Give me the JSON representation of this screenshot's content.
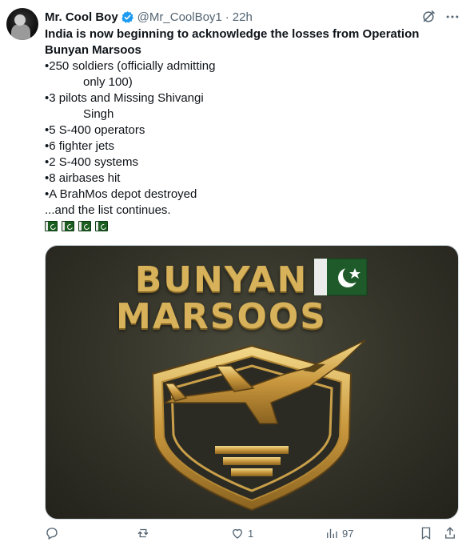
{
  "tweet": {
    "author_name": "Mr. Cool Boy",
    "handle": "@Mr_CoolBoy1",
    "separator": "·",
    "time": "22h",
    "title": "India is now beginning to acknowledge the losses from Operation Bunyan Marsoos",
    "lines": [
      "•250 soldiers (officially admitting",
      "only 100)",
      "•3 pilots and Missing Shivangi",
      "Singh",
      "•5 S-400 operators",
      "•6 fighter jets",
      "•2 S-400 systems",
      "•8 airbases hit",
      "•A BrahMos depot destroyed",
      "...and the list continues."
    ],
    "flag_emojis": [
      "pakistan-flag",
      "pakistan-flag",
      "pakistan-flag",
      "pakistan-flag"
    ]
  },
  "media": {
    "headline_line1": "BUNYAN",
    "headline_line2": "MARSOOS",
    "description_icons": [
      "pakistan-flag",
      "fighter-jet",
      "shield-emblem"
    ]
  },
  "actions": {
    "reply_count": "",
    "retweet_count": "",
    "like_count": "1",
    "views_count": "97"
  },
  "colors": {
    "accent": "#1d9bf0",
    "muted": "#536471",
    "gold": "#d8b25a",
    "flag_green": "#1b5e20"
  }
}
